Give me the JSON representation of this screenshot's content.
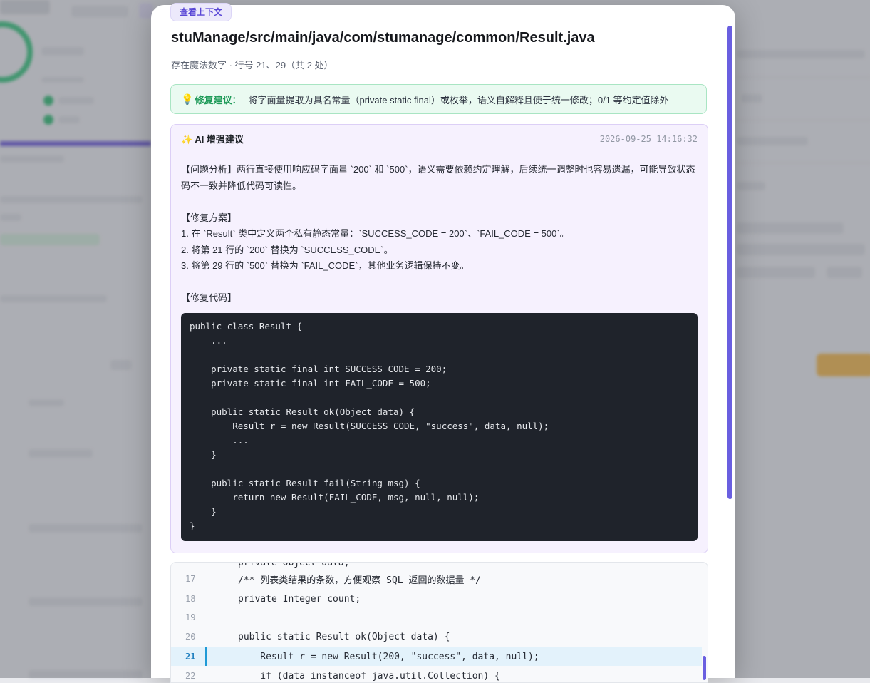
{
  "context_button": "查看上下文",
  "file_path": "stuManage/src/main/java/com/stumanage/common/Result.java",
  "issue_meta": "存在魔法数字 · 行号 21、29（共 2 处）",
  "fix_tip": {
    "icon": "lightbulb-icon",
    "label": "修复建议：",
    "text": "将字面量提取为具名常量（private static final）或枚举，语义自解释且便于统一修改；0/1 等约定值除外"
  },
  "ai_suggestion": {
    "title": "✨ AI 增强建议",
    "timestamp": "2026-09-25 14:16:32",
    "analysis": "【问题分析】两行直接使用响应码字面量 `200` 和 `500`，语义需要依赖约定理解，后续统一调整时也容易遗漏，可能导致状态码不一致并降低代码可读性。",
    "plan_heading": "【修复方案】",
    "plan_steps": [
      "1. 在 `Result` 类中定义两个私有静态常量：`SUCCESS_CODE = 200`、`FAIL_CODE = 500`。",
      "2. 将第 21 行的 `200` 替换为 `SUCCESS_CODE`。",
      "3. 将第 29 行的 `500` 替换为 `FAIL_CODE`，其他业务逻辑保持不变。"
    ],
    "code_heading": "【修复代码】",
    "code": "public class Result {\n    ...\n\n    private static final int SUCCESS_CODE = 200;\n    private static final int FAIL_CODE = 500;\n\n    public static Result ok(Object data) {\n        Result r = new Result(SUCCESS_CODE, \"success\", data, null);\n        ...\n    }\n\n    public static Result fail(String msg) {\n        return new Result(FAIL_CODE, msg, null, null);\n    }\n}"
  },
  "source_lines": [
    {
      "num": "",
      "code": "private Object data;"
    },
    {
      "num": "17",
      "code": "/** 列表类结果的条数，方便观察 SQL 返回的数据量 */"
    },
    {
      "num": "18",
      "code": "private Integer count;"
    },
    {
      "num": "19",
      "code": ""
    },
    {
      "num": "20",
      "code": "public static Result ok(Object data) {"
    },
    {
      "num": "21",
      "code": "    Result r = new Result(200, \"success\", data, null);",
      "highlight": true
    },
    {
      "num": "22",
      "code": "    if (data instanceof java.util.Collection) {"
    }
  ],
  "colors": {
    "accent": "#6a5fe0",
    "tip_green": "#1e9a58",
    "highlight_blue": "#1f9ad6"
  }
}
